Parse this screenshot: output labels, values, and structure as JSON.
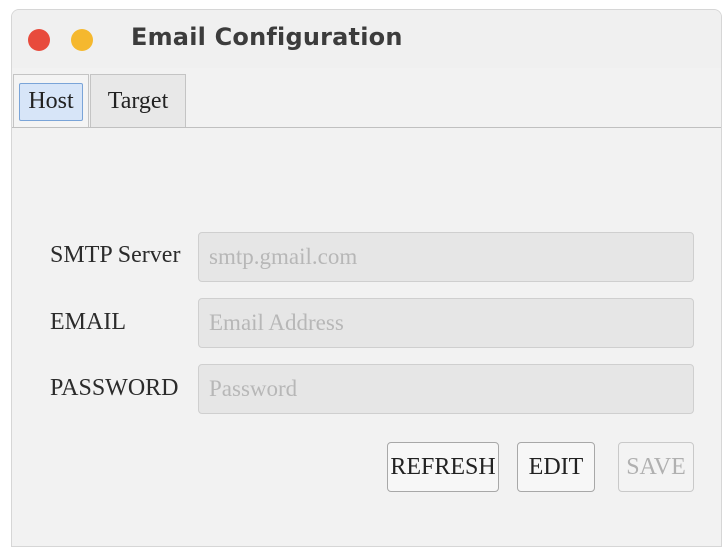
{
  "window": {
    "title": "Email Configuration",
    "controls": {
      "close_color": "#e84b3c",
      "minimize_color": "#f5b82e"
    }
  },
  "tabs": [
    {
      "label": "Host",
      "active": true
    },
    {
      "label": "Target",
      "active": false
    }
  ],
  "form": {
    "smtp_server": {
      "label": "SMTP Server",
      "value": "",
      "placeholder": "smtp.gmail.com"
    },
    "email": {
      "label": "EMAIL",
      "value": "",
      "placeholder": "Email Address"
    },
    "password": {
      "label": "PASSWORD",
      "value": "",
      "placeholder": "Password"
    }
  },
  "buttons": {
    "refresh": "REFRESH",
    "edit": "EDIT",
    "save": "SAVE"
  },
  "colors": {
    "active_tab_fill": "#d7e5f8",
    "active_tab_border": "#7aa4d8",
    "disabled_text": "#b0b0b0"
  }
}
